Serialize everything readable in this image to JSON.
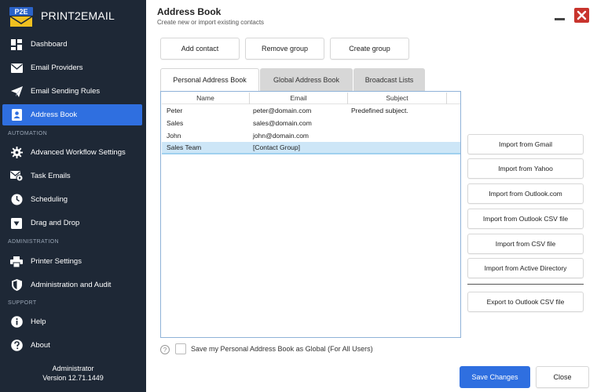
{
  "app": {
    "logo_text": "P2E",
    "name": "PRINT2EMAIL",
    "brand_color": "#2f6fe0",
    "sidebar_color": "#1e2836"
  },
  "sidebar": {
    "items": [
      {
        "label": "Dashboard",
        "icon": "dashboard-icon"
      },
      {
        "label": "Email Providers",
        "icon": "envelope-icon"
      },
      {
        "label": "Email Sending Rules",
        "icon": "paper-plane-icon"
      },
      {
        "label": "Address Book",
        "icon": "contact-book-icon",
        "active": true
      }
    ],
    "section_automation": "AUTOMATION",
    "automation_items": [
      {
        "label": "Advanced Workflow Settings",
        "icon": "gear-icon"
      },
      {
        "label": "Task Emails",
        "icon": "task-email-icon"
      },
      {
        "label": "Scheduling",
        "icon": "clock-icon"
      },
      {
        "label": "Drag and Drop",
        "icon": "drag-drop-icon"
      }
    ],
    "section_administration": "ADMINISTRATION",
    "admin_items": [
      {
        "label": "Printer Settings",
        "icon": "printer-icon"
      },
      {
        "label": "Administration and Audit",
        "icon": "shield-icon"
      }
    ],
    "section_support": "SUPPORT",
    "support_items": [
      {
        "label": "Help",
        "icon": "info-icon"
      },
      {
        "label": "About",
        "icon": "question-icon"
      }
    ],
    "footer_user": "Administrator",
    "footer_version": "Version 12.71.1449"
  },
  "header": {
    "title": "Address Book",
    "subtitle": "Create new or import existing contacts"
  },
  "toolbar": {
    "add_contact": "Add contact",
    "remove_group": "Remove group",
    "create_group": "Create group"
  },
  "tabs": [
    {
      "label": "Personal Address Book",
      "active": true
    },
    {
      "label": "Global Address Book",
      "active": false
    },
    {
      "label": "Broadcast Lists",
      "active": false
    }
  ],
  "table": {
    "columns": [
      "Name",
      "Email",
      "Subject"
    ],
    "rows": [
      {
        "name": "Peter",
        "email": "peter@domain.com",
        "subject": "Predefined subject."
      },
      {
        "name": "Sales",
        "email": "sales@domain.com",
        "subject": ""
      },
      {
        "name": "John",
        "email": "john@domain.com",
        "subject": ""
      },
      {
        "name": "Sales Team",
        "email": "[Contact Group]",
        "subject": "",
        "selected": true
      }
    ]
  },
  "import_buttons": [
    "Import from Gmail",
    "Import from Yahoo",
    "Import from Outlook.com",
    "Import from Outlook CSV file",
    "Import from CSV file",
    "Import from Active Directory"
  ],
  "export_button": "Export to Outlook CSV file",
  "footer": {
    "help_glyph": "?",
    "checkbox_label": "Save my Personal Address Book as Global (For All Users)",
    "checkbox_checked": false,
    "save": "Save Changes",
    "close": "Close"
  }
}
